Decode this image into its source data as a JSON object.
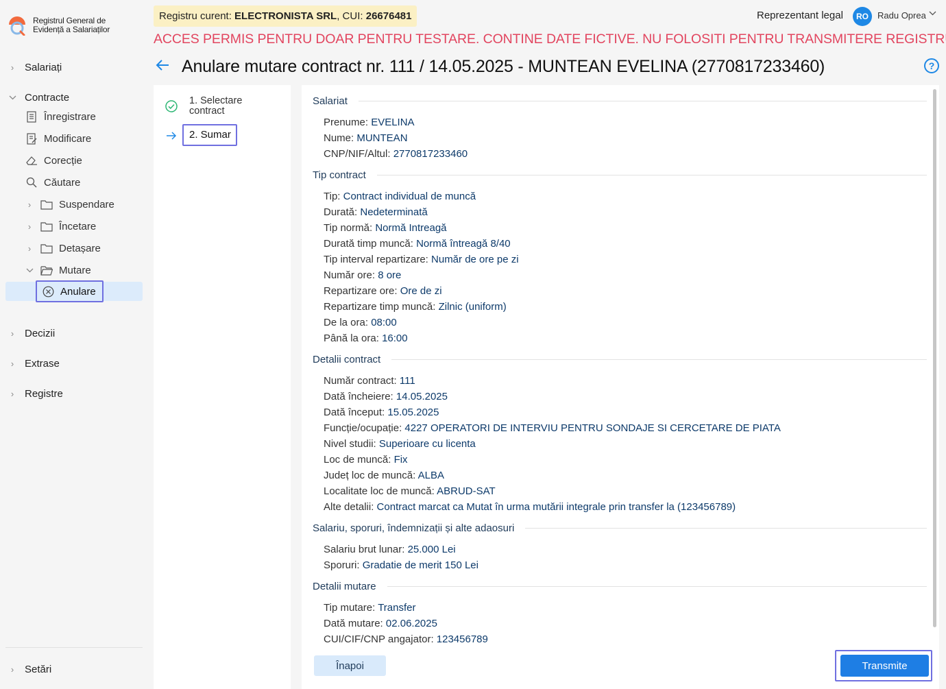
{
  "app": {
    "name_line1": "Registrul General de",
    "name_line2": "Evidență a Salariaților"
  },
  "sidebar": {
    "salariati": "Salariați",
    "contracte": "Contracte",
    "contracte_items": {
      "inregistrare": "Înregistrare",
      "modificare": "Modificare",
      "corectie": "Corecție",
      "cautare": "Căutare",
      "suspendare": "Suspendare",
      "incetare": "Încetare",
      "detasare": "Detașare",
      "mutare": "Mutare",
      "anulare": "Anulare"
    },
    "decizii": "Decizii",
    "extrase": "Extrase",
    "registre": "Registre",
    "setari": "Setări"
  },
  "header": {
    "registry_prefix": "Registru curent: ",
    "registry_company": "ELECTRONISTA SRL",
    "registry_cui_prefix": ", CUI: ",
    "registry_cui": "26676481",
    "rep_label": "Reprezentant legal",
    "avatar_initials": "RO",
    "user_name": "Radu Oprea",
    "warning": "ACCES PERMIS PENTRU DOAR PENTRU TESTARE. CONTINE DATE FICTIVE. NU FOLOSITI PENTRU TRANSMITERE REGISTRU",
    "title": "Anulare mutare contract nr. 111 / 14.05.2025 - MUNTEAN EVELINA (2770817233460)"
  },
  "steps": {
    "step1": "1. Selectare contract",
    "step2": "2. Sumar"
  },
  "summary": {
    "salariat": {
      "title": "Salariat",
      "prenume_label": "Prenume: ",
      "prenume": "EVELINA",
      "nume_label": "Nume: ",
      "nume": "MUNTEAN",
      "cnp_label": "CNP/NIF/Altul: ",
      "cnp": "2770817233460"
    },
    "tip_contract": {
      "title": "Tip contract",
      "tip_label": "Tip: ",
      "tip": "Contract individual de muncă",
      "durata_label": "Durată: ",
      "durata": "Nedeterminată",
      "norma_label": "Tip normă: ",
      "norma": "Normă Intreagă",
      "durata_timp_label": "Durată timp muncă: ",
      "durata_timp": "Normă întreagă 8/40",
      "interval_label": "Tip interval repartizare: ",
      "interval": "Număr de ore pe zi",
      "nr_ore_label": "Număr ore: ",
      "nr_ore": "8 ore",
      "repartizare_ore_label": "Repartizare ore: ",
      "repartizare_ore": "Ore de zi",
      "repartizare_timp_label": "Repartizare timp muncă: ",
      "repartizare_timp": "Zilnic (uniform)",
      "de_la_label": "De la ora: ",
      "de_la": "08:00",
      "pana_la_label": "Până la ora: ",
      "pana_la": "16:00"
    },
    "detalii_contract": {
      "title": "Detalii contract",
      "numar_label": "Număr contract: ",
      "numar": "111",
      "data_incheiere_label": "Dată încheiere: ",
      "data_incheiere": "14.05.2025",
      "data_inceput_label": "Dată început: ",
      "data_inceput": "15.05.2025",
      "functie_label": "Funcție/ocupație: ",
      "functie": "4227 OPERATORI DE INTERVIU PENTRU SONDAJE SI CERCETARE DE PIATA",
      "studii_label": "Nivel studii: ",
      "studii": "Superioare cu licenta",
      "loc_label": "Loc de muncă: ",
      "loc": "Fix",
      "judet_label": "Județ loc de muncă: ",
      "judet": "ALBA",
      "localitate_label": "Localitate loc de muncă: ",
      "localitate": "ABRUD-SAT",
      "alte_label": "Alte detalii: ",
      "alte": "Contract marcat ca Mutat în urma mutării integrale prin transfer la (123456789)"
    },
    "salariu": {
      "title": "Salariu, sporuri, îndemnizații și alte adaosuri",
      "brut_label": "Salariu brut lunar: ",
      "brut": "25.000 Lei",
      "sporuri_label": "Sporuri: ",
      "sporuri": "Gradatie de merit 150 Lei"
    },
    "mutare": {
      "title": "Detalii mutare",
      "tip_label": "Tip mutare: ",
      "tip": "Transfer",
      "data_label": "Dată mutare: ",
      "data": "02.06.2025",
      "cui_label": "CUI/CIF/CNP angajator: ",
      "cui": "123456789"
    }
  },
  "actions": {
    "back": "Înapoi",
    "submit": "Transmite"
  },
  "colors": {
    "accent": "#1e88e5",
    "warning": "#e2455f",
    "value_text": "#0d3a6a",
    "badge_bg": "#fbf0c4",
    "focus_outline": "#6f6fe0"
  }
}
